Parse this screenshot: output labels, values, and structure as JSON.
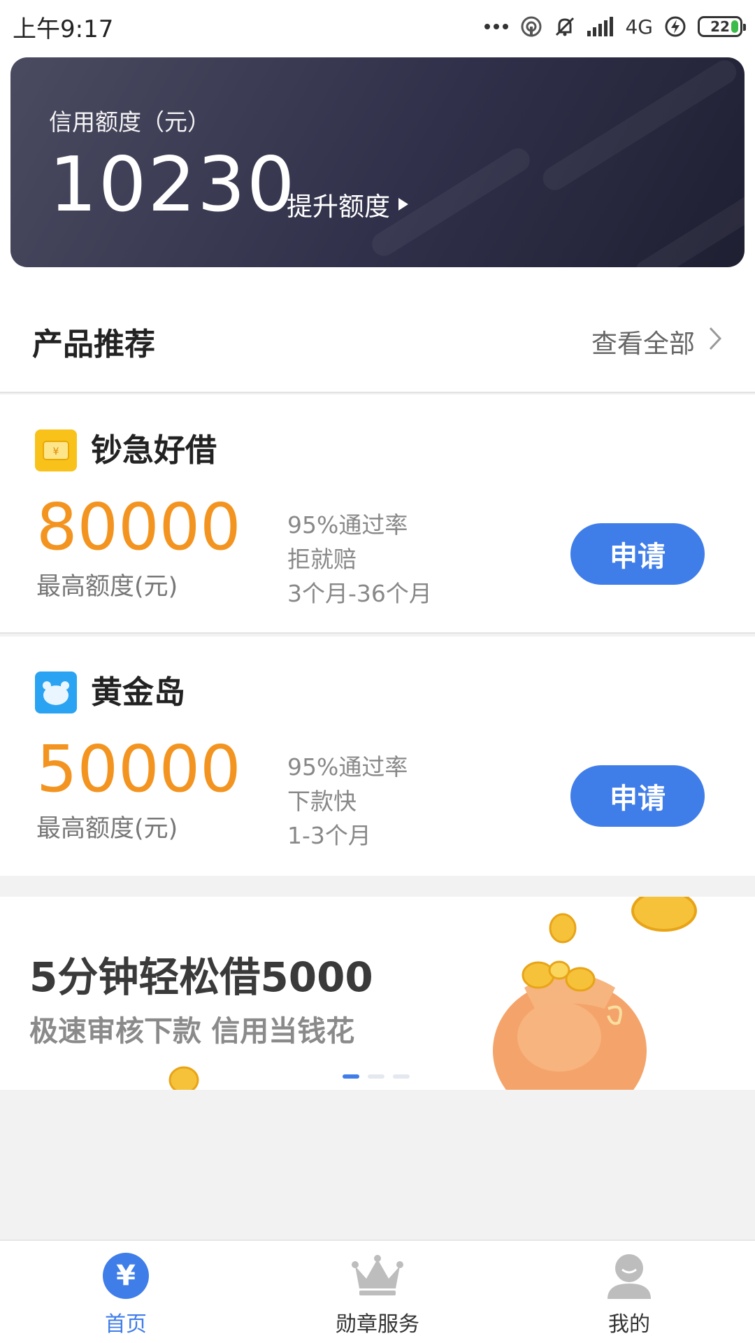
{
  "status_bar": {
    "time": "上午9:17",
    "network": "4G",
    "battery": "22",
    "icons": [
      "more-dots-icon",
      "hotspot-icon",
      "mute-bell-icon",
      "signal-icon",
      "network-4g-icon",
      "charging-icon",
      "battery-icon"
    ]
  },
  "credit": {
    "label": "信用额度（元）",
    "amount": "10230",
    "raise_label": "提升额度"
  },
  "section": {
    "title": "产品推荐",
    "see_all": "查看全部"
  },
  "products": [
    {
      "name": "钞急好借",
      "amount": "80000",
      "amount_label": "最高额度(元)",
      "features": [
        "95%通过率",
        "拒就赔",
        "3个月-36个月"
      ],
      "apply_label": "申请",
      "logo_color": "#f9c21a",
      "logo_icon": "wallet-icon"
    },
    {
      "name": "黄金岛",
      "amount": "50000",
      "amount_label": "最高额度(元)",
      "features": [
        "95%通过率",
        "下款快",
        "1-3个月"
      ],
      "apply_label": "申请",
      "logo_color": "#2aa3f2",
      "logo_icon": "bear-icon"
    }
  ],
  "banner": {
    "title": "5分钟轻松借5000",
    "subtitle": "极速审核下款 信用当钱花",
    "slides": 3,
    "active_slide": 1
  },
  "tabs": [
    {
      "label": "首页",
      "icon": "yen-icon",
      "active": true
    },
    {
      "label": "勋章服务",
      "icon": "crown-icon",
      "active": false
    },
    {
      "label": "我的",
      "icon": "user-icon",
      "active": false
    }
  ],
  "colors": {
    "accent": "#3f7de9",
    "amount": "#f39420",
    "card_dark": "#2a2a40"
  }
}
